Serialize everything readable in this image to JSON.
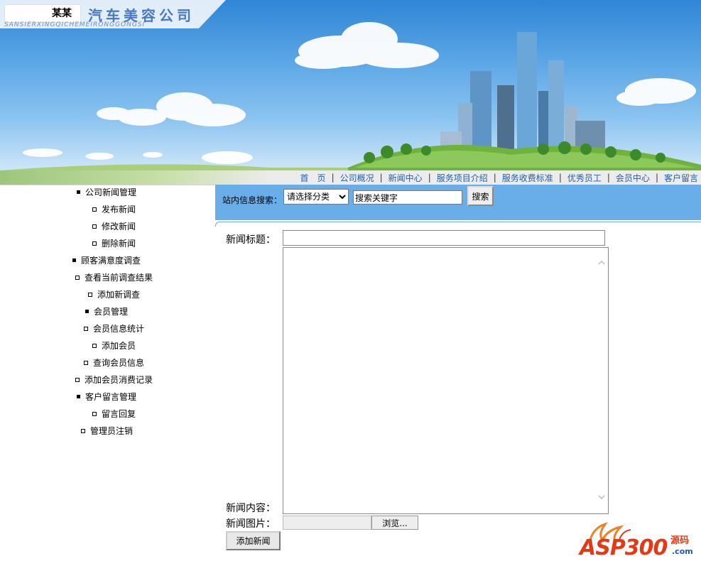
{
  "header": {
    "company_short": "某某",
    "company_name": "汽车美容公司",
    "company_pinyin": "SANSIERXINGQICHEMEIRONGGONGSI"
  },
  "nav": {
    "items": [
      "首　页",
      "公司概况",
      "新闻中心",
      "服务项目介绍",
      "服务收费标准",
      "优秀员工",
      "会员中心",
      "客户留言"
    ],
    "separator": "|"
  },
  "sidebar": {
    "items": [
      {
        "label": "公司新闻管理",
        "bullet": "filled"
      },
      {
        "label": "发布新闻",
        "bullet": "hollow"
      },
      {
        "label": "修改新闻",
        "bullet": "hollow"
      },
      {
        "label": "删除新闻",
        "bullet": "hollow"
      },
      {
        "label": "顾客满意度调查",
        "bullet": "filled"
      },
      {
        "label": "查看当前调查结果",
        "bullet": "hollow"
      },
      {
        "label": "添加新调查",
        "bullet": "hollow"
      },
      {
        "label": "会员管理",
        "bullet": "filled"
      },
      {
        "label": "会员信息统计",
        "bullet": "hollow"
      },
      {
        "label": "添加会员",
        "bullet": "hollow"
      },
      {
        "label": "查询会员信息",
        "bullet": "hollow"
      },
      {
        "label": "添加会员消费记录",
        "bullet": "hollow"
      },
      {
        "label": "客户留言管理",
        "bullet": "filled"
      },
      {
        "label": "留言回复",
        "bullet": "hollow"
      },
      {
        "label": "管理员注销",
        "bullet": "hollow"
      }
    ]
  },
  "search": {
    "label": "站内信息搜索：",
    "category_selected": "请选择分类",
    "keyword_value": "搜索关键字",
    "button_label": "搜索"
  },
  "form": {
    "title_label": "新闻标题：",
    "title_value": "",
    "content_label": "新闻内容：",
    "content_value": "",
    "image_label": "新闻图片：",
    "browse_label": "浏览...",
    "submit_label": "添加新闻"
  },
  "watermark": {
    "brand": "ASP300",
    "sub": "源码",
    "domain": ".com"
  },
  "colors": {
    "nav_link": "#1f5fa8",
    "search_bar_bg": "#6aaee9",
    "sky_top": "#2f86d6",
    "watermark_red": "#e23a16"
  }
}
